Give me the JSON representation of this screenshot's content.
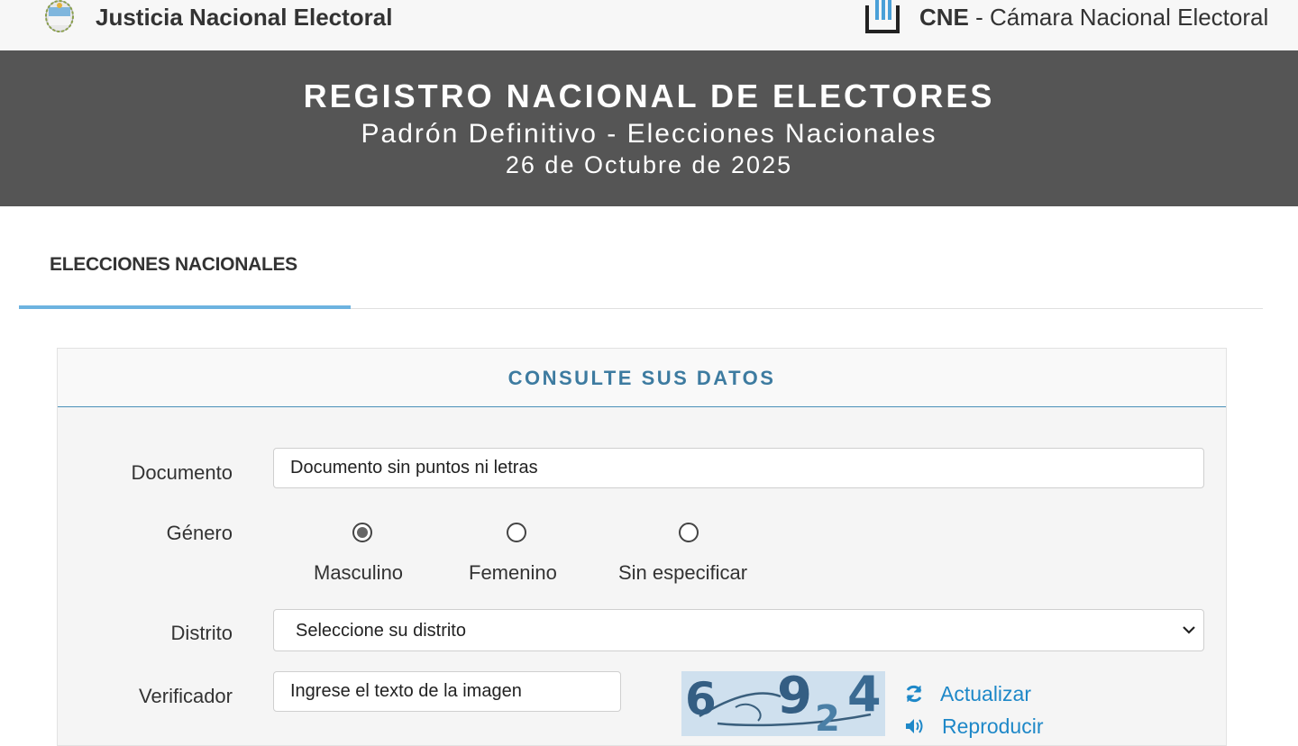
{
  "topbar": {
    "left_title": "Justicia Nacional Electoral",
    "right_abbr": "CNE",
    "right_title": " - Cámara Nacional Electoral"
  },
  "banner": {
    "title": "REGISTRO NACIONAL DE ELECTORES",
    "subtitle": "Padrón Definitivo - Elecciones Nacionales",
    "date": "26 de Octubre de 2025"
  },
  "tabs": [
    {
      "label": "ELECCIONES NACIONALES",
      "active": true
    }
  ],
  "form": {
    "title": "CONSULTE SUS DATOS",
    "documento": {
      "label": "Documento",
      "placeholder": "Documento sin puntos ni letras",
      "value": ""
    },
    "genero": {
      "label": "Género",
      "options": [
        {
          "label": "Masculino",
          "checked": true
        },
        {
          "label": "Femenino",
          "checked": false
        },
        {
          "label": "Sin especificar",
          "checked": false
        }
      ]
    },
    "distrito": {
      "label": "Distrito",
      "selected": "Seleccione su distrito"
    },
    "verificador": {
      "label": "Verificador",
      "placeholder": "Ingrese el texto de la imagen",
      "value": ""
    },
    "captcha": {
      "chars": [
        "6",
        "9",
        "2",
        "4"
      ],
      "refresh_label": "Actualizar",
      "audio_label": "Reproducir"
    }
  },
  "colors": {
    "banner_bg": "#555555",
    "accent": "#3d7ba0",
    "link": "#1e88c8",
    "tab_underline": "#6db3e0"
  },
  "icons": [
    "argentina-seal-icon",
    "cne-logo-icon",
    "chevron-down-icon",
    "refresh-icon",
    "speaker-icon"
  ]
}
